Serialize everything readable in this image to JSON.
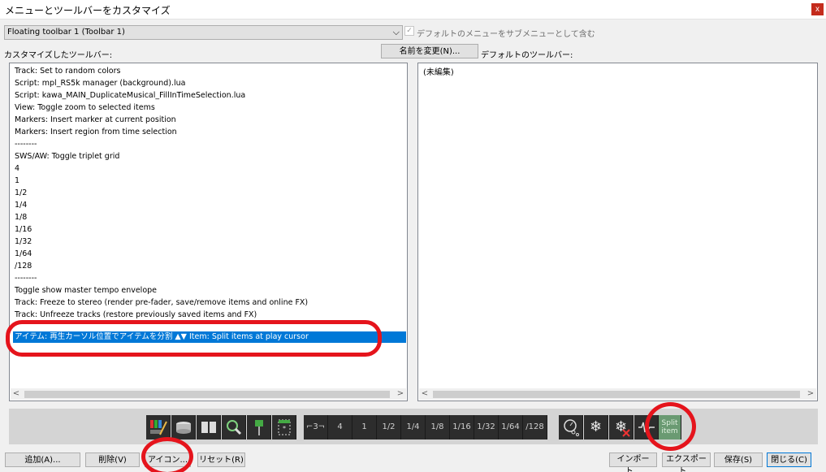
{
  "window": {
    "title": "メニューとツールバーをカスタマイズ",
    "close_label": "x"
  },
  "toolbar_select": {
    "value": "Floating toolbar 1 (Toolbar 1)",
    "arrow": "⌵"
  },
  "default_submenu": {
    "checked": true,
    "check_glyph": "✓",
    "label": "デフォルトのメニューをサブメニューとして含む"
  },
  "labels": {
    "customized": "カスタマイズしたツールバー:",
    "default": "デフォルトのツールバー:"
  },
  "rename_button": "名前を変更(N)...",
  "customized_items": [
    "Track: Set to random colors",
    "Script: mpl_RS5k manager (background).lua",
    "Script: kawa_MAIN_DuplicateMusical_FillInTimeSelection.lua",
    "View: Toggle zoom to selected items",
    "Markers: Insert marker at current position",
    "Markers: Insert region from time selection",
    "--------",
    "SWS/AW: Toggle triplet grid",
    "4",
    "1",
    "1/2",
    "1/4",
    "1/8",
    "1/16",
    "1/32",
    "1/64",
    "/128",
    "--------",
    "Toggle show master tempo envelope",
    "Track: Freeze to stereo (render pre-fader, save/remove items and online FX)",
    "Track: Unfreeze tracks (restore previously saved items and FX)"
  ],
  "selected_item": "アイテム: 再生カーソル位置でアイテムを分割 ▲▼ Item: Split items at play cursor",
  "default_items_placeholder": "(未編集)",
  "scroll": {
    "left": "<",
    "right": ">"
  },
  "toolbar_preview": {
    "grid_buttons": [
      "⌐3¬",
      "4",
      "1",
      "1/2",
      "1/4",
      "1/8",
      "1/16",
      "1/32",
      "1/64",
      "/128"
    ],
    "split_item_label": "Split item",
    "snowflake": "❄"
  },
  "buttons": {
    "add": "追加(A)...",
    "delete": "削除(V)",
    "icon": "アイコン...",
    "reset": "リセット(R)",
    "import": "インポート...",
    "export": "エクスポート...",
    "save": "保存(S)",
    "close": "閉じる(C)"
  },
  "colors": {
    "selection": "#0078d7",
    "annotation": "#e5141c",
    "toolbar_bg": "#2d2d2d",
    "split_item_bg": "#6a9a72"
  }
}
